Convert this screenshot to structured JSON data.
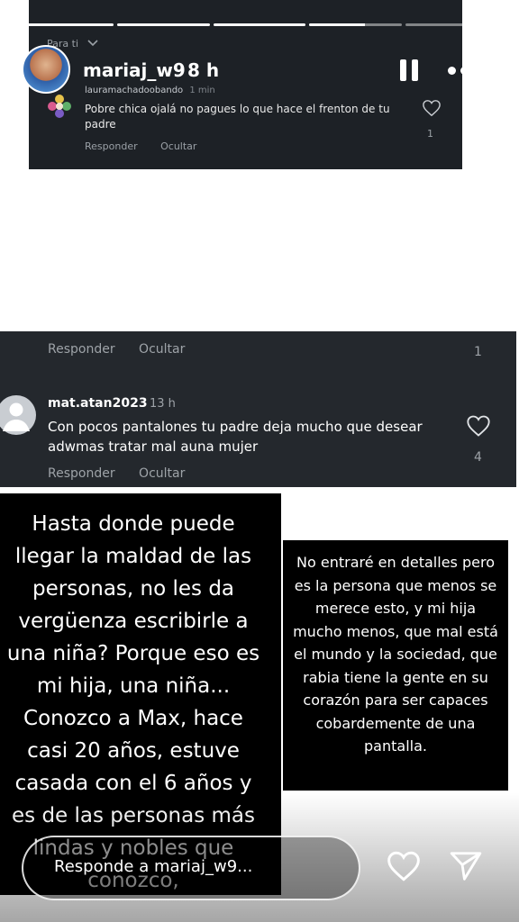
{
  "story": {
    "username": "mariaj_w9",
    "time": "8 h",
    "progress": [
      1.0,
      1.0,
      1.0,
      0.6,
      0.0
    ]
  },
  "screenshot_top": {
    "header": "Para ti",
    "comment": {
      "username": "lauramachadoobando",
      "time": "1 min",
      "text": "Pobre chica ojalá no pagues lo que hace el frenton de tu padre",
      "reply_label": "Responder",
      "hide_label": "Ocultar",
      "likes": "1"
    }
  },
  "screenshot_mid": {
    "prev_actions": {
      "reply_label": "Responder",
      "hide_label": "Ocultar",
      "likes": "1"
    },
    "comment": {
      "username": "mat.atan2023",
      "time": "13 h",
      "text": "Con pocos pantalones tu padre deja mucho que desear adwmas tratar mal auna mujer",
      "reply_label": "Responder",
      "hide_label": "Ocultar",
      "likes": "4"
    }
  },
  "text_left": "Hasta donde puede llegar la maldad de las personas, no les da vergüenza escribirle a una niña? Porque eso es mi hija, una niña... Conozco a Max, hace casi 20 años, estuve casada con el 6 años y es de las personas más lindas y nobles que conozco,",
  "text_right": "No entraré en detalles pero es la persona que menos se merece esto, y mi hija mucho menos, que mal está el mundo y la sociedad, que rabia tiene la gente en su corazón para ser capaces cobardemente de una pantalla.",
  "reply_bar": {
    "placeholder": "Responde a mariaj_w9..."
  },
  "icons": {
    "like": "heart-icon",
    "send": "paper-plane-icon",
    "pause": "pause-icon",
    "more": "more-icon"
  }
}
